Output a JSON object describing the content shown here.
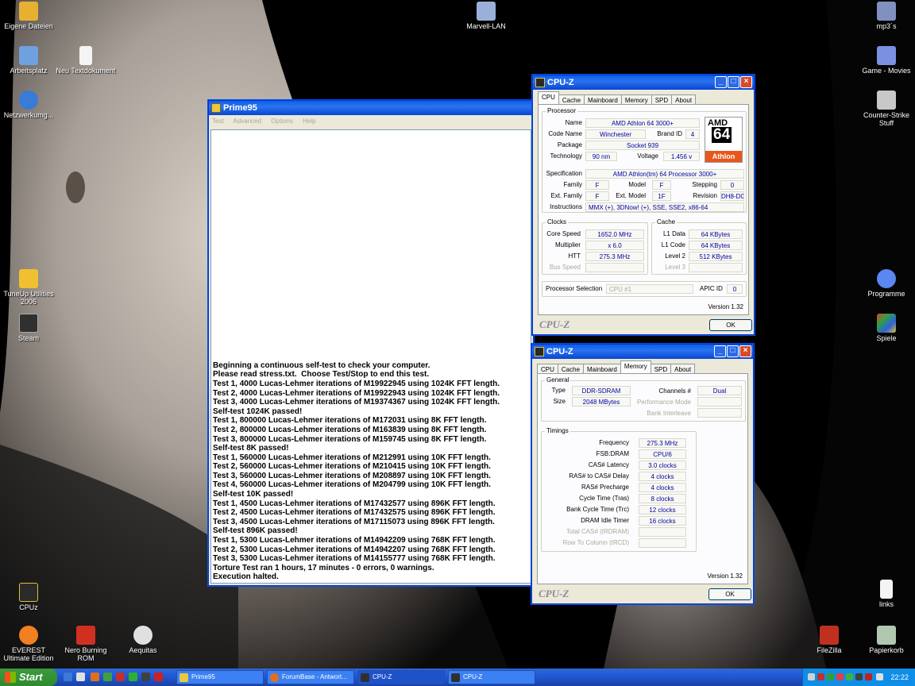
{
  "desktop": {
    "icons": [
      {
        "label": "Eigene Dateien",
        "name": "eigene-dateien",
        "color": "#e8b030"
      },
      {
        "label": "Arbeitsplatz",
        "name": "arbeitsplatz",
        "color": "#6fa0e0"
      },
      {
        "label": "Netzwerkumg...",
        "name": "netzwerkumgebung",
        "color": "#3a7ad8"
      },
      {
        "label": "Neu Textdokument",
        "name": "neu-textdokument",
        "color": "#f4f4f4"
      },
      {
        "label": "Marvell-LAN",
        "name": "marvell-lan",
        "color": "#9ab0d8"
      },
      {
        "label": "mp3´s",
        "name": "mp3s",
        "color": "#8090c0"
      },
      {
        "label": "Game - Movies",
        "name": "game-movies",
        "color": "#7a90e0"
      },
      {
        "label": "Counter-Strike Stuff",
        "name": "counter-strike-stuff",
        "color": "#c8c8c8"
      },
      {
        "label": "TuneUp Utilities 2006",
        "name": "tuneup-utilities",
        "color": "#f0c030"
      },
      {
        "label": "Steam",
        "name": "steam",
        "color": "#303030"
      },
      {
        "label": "Programme",
        "name": "programme",
        "color": "#5a88f0"
      },
      {
        "label": "Spiele",
        "name": "spiele",
        "color": "#e04030"
      },
      {
        "label": "CPUz",
        "name": "cpuz",
        "color": "#2a2a2a"
      },
      {
        "label": "links",
        "name": "links",
        "color": "#f4f4f4"
      },
      {
        "label": "EVEREST Ultimate Edition",
        "name": "everest",
        "color": "#f08020"
      },
      {
        "label": "Nero Burning ROM",
        "name": "nero",
        "color": "#d03020"
      },
      {
        "label": "Aequitas",
        "name": "aequitas",
        "color": "#e0e0e0"
      },
      {
        "label": "FileZilla",
        "name": "filezilla",
        "color": "#c03020"
      },
      {
        "label": "Papierkorb",
        "name": "papierkorb",
        "color": "#b0c8b0"
      }
    ]
  },
  "prime95": {
    "title": "Prime95",
    "menu": [
      "Test",
      "Advanced",
      "Options",
      "Help"
    ],
    "log": [
      "Beginning a continuous self-test to check your computer.",
      "Please read stress.txt.  Choose Test/Stop to end this test.",
      "Test 1, 4000 Lucas-Lehmer iterations of M19922945 using 1024K FFT length.",
      "Test 2, 4000 Lucas-Lehmer iterations of M19922943 using 1024K FFT length.",
      "Test 3, 4000 Lucas-Lehmer iterations of M19374367 using 1024K FFT length.",
      "Self-test 1024K passed!",
      "Test 1, 800000 Lucas-Lehmer iterations of M172031 using 8K FFT length.",
      "Test 2, 800000 Lucas-Lehmer iterations of M163839 using 8K FFT length.",
      "Test 3, 800000 Lucas-Lehmer iterations of M159745 using 8K FFT length.",
      "Self-test 8K passed!",
      "Test 1, 560000 Lucas-Lehmer iterations of M212991 using 10K FFT length.",
      "Test 2, 560000 Lucas-Lehmer iterations of M210415 using 10K FFT length.",
      "Test 3, 560000 Lucas-Lehmer iterations of M208897 using 10K FFT length.",
      "Test 4, 560000 Lucas-Lehmer iterations of M204799 using 10K FFT length.",
      "Self-test 10K passed!",
      "Test 1, 4500 Lucas-Lehmer iterations of M17432577 using 896K FFT length.",
      "Test 2, 4500 Lucas-Lehmer iterations of M17432575 using 896K FFT length.",
      "Test 3, 4500 Lucas-Lehmer iterations of M17115073 using 896K FFT length.",
      "Self-test 896K passed!",
      "Test 1, 5300 Lucas-Lehmer iterations of M14942209 using 768K FFT length.",
      "Test 2, 5300 Lucas-Lehmer iterations of M14942207 using 768K FFT length.",
      "Test 3, 5300 Lucas-Lehmer iterations of M14155777 using 768K FFT length.",
      "Torture Test ran 1 hours, 17 minutes - 0 errors, 0 warnings.",
      "Execution halted."
    ]
  },
  "cpuz_cpu": {
    "title": "CPU-Z",
    "tabs": [
      "CPU",
      "Cache",
      "Mainboard",
      "Memory",
      "SPD",
      "About"
    ],
    "active_tab": "CPU",
    "processor_group": "Processor",
    "name_label": "Name",
    "name": "AMD Athlon 64 3000+",
    "codename_label": "Code Name",
    "codename": "Winchester",
    "brandid_label": "Brand ID",
    "brandid": "4",
    "package_label": "Package",
    "package": "Socket 939",
    "technology_label": "Technology",
    "technology": "90 nm",
    "voltage_label": "Voltage",
    "voltage": "1.456 v",
    "spec_label": "Specification",
    "spec": "AMD Athlon(tm) 64 Processor 3000+",
    "family_label": "Family",
    "family": "F",
    "model_label": "Model",
    "model": "F",
    "stepping_label": "Stepping",
    "stepping": "0",
    "extfamily_label": "Ext. Family",
    "extfamily": "F",
    "extmodel_label": "Ext. Model",
    "extmodel": "1F",
    "revision_label": "Revision",
    "revision": "DH8-D0",
    "instructions_label": "Instructions",
    "instructions": "MMX (+), 3DNow! (+), SSE, SSE2, x86-64",
    "logo": {
      "amd": "AMD",
      "num": "64",
      "athlon": "Athlon"
    },
    "clocks_group": "Clocks",
    "corespeed_label": "Core Speed",
    "corespeed": "1652.0 MHz",
    "multiplier_label": "Multiplier",
    "multiplier": "x 6.0",
    "htt_label": "HTT",
    "htt": "275.3 MHz",
    "busspeed_label": "Bus Speed",
    "cache_group": "Cache",
    "l1data_label": "L1 Data",
    "l1data": "64 KBytes",
    "l1code_label": "L1 Code",
    "l1code": "64 KBytes",
    "level2_label": "Level 2",
    "level2": "512 KBytes",
    "level3_label": "Level 3",
    "procsel_label": "Processor Selection",
    "procsel": "CPU #1",
    "apicid_label": "APIC ID",
    "apicid": "0",
    "version": "Version 1.32",
    "brand": "CPU-Z",
    "ok": "OK"
  },
  "cpuz_mem": {
    "title": "CPU-Z",
    "tabs": [
      "CPU",
      "Cache",
      "Mainboard",
      "Memory",
      "SPD",
      "About"
    ],
    "active_tab": "Memory",
    "general_group": "General",
    "type_label": "Type",
    "type": "DDR-SDRAM",
    "channels_label": "Channels #",
    "channels": "Dual",
    "size_label": "Size",
    "size": "2048 MBytes",
    "perfmode_label": "Performance Mode",
    "bankinterleave_label": "Bank Interleave",
    "timings_group": "Timings",
    "frequency_label": "Frequency",
    "frequency": "275.3 MHz",
    "fsbdram_label": "FSB:DRAM",
    "fsbdram": "CPU/6",
    "cas_label": "CAS# Latency",
    "cas": "3.0 clocks",
    "rcd_label": "RAS# to CAS# Delay",
    "rcd": "4 clocks",
    "rp_label": "RAS# Precharge",
    "rp": "4 clocks",
    "tras_label": "Cycle Time (Tras)",
    "tras": "8 clocks",
    "trc_label": "Bank Cycle Time (Trc)",
    "trc": "12 clocks",
    "idle_label": "DRAM Idle Timer",
    "idle": "16 clocks",
    "totalcas_label": "Total CAS# (tRDRAM)",
    "rowtocol_label": "Row To Column (tRCD)",
    "version": "Version 1.32",
    "brand": "CPU-Z",
    "ok": "OK"
  },
  "taskbar": {
    "start": "Start",
    "items": [
      {
        "label": "Prime95",
        "color": "#e8c840"
      },
      {
        "label": "ForumBase - Antwort...",
        "color": "#e07020"
      },
      {
        "label": "CPU-Z",
        "color": "#303030"
      },
      {
        "label": "CPU-Z",
        "color": "#303030"
      }
    ],
    "clock": "22:22"
  }
}
